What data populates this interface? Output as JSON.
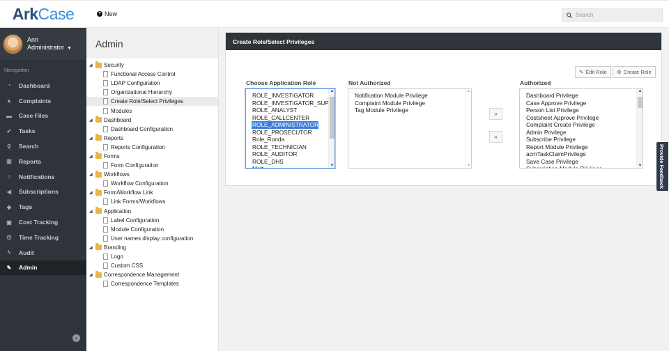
{
  "brand": {
    "part1": "Ark",
    "part2": "Case"
  },
  "header": {
    "new_label": "New",
    "search_placeholder": "Search"
  },
  "user": {
    "first": "Ann",
    "role": "Administrator"
  },
  "nav": {
    "heading": "Navigation",
    "items": [
      {
        "label": "Dashboard",
        "icon": "dashboard-icon",
        "glyph": "◔"
      },
      {
        "label": "Complaints",
        "icon": "warning-icon",
        "glyph": "▲"
      },
      {
        "label": "Case Files",
        "icon": "folder-icon",
        "glyph": "▬"
      },
      {
        "label": "Tasks",
        "icon": "check-circle-icon",
        "glyph": "✔"
      },
      {
        "label": "Search",
        "icon": "search-icon",
        "glyph": "⚲"
      },
      {
        "label": "Reports",
        "icon": "bar-chart-icon",
        "glyph": "▥"
      },
      {
        "label": "Notifications",
        "icon": "bell-icon",
        "glyph": "♫"
      },
      {
        "label": "Subscriptions",
        "icon": "bullhorn-icon",
        "glyph": "◀"
      },
      {
        "label": "Tags",
        "icon": "tag-icon",
        "glyph": "◆"
      },
      {
        "label": "Cost Tracking",
        "icon": "money-icon",
        "glyph": "▣"
      },
      {
        "label": "Time Tracking",
        "icon": "clock-icon",
        "glyph": "◷"
      },
      {
        "label": "Audit",
        "icon": "bolt-icon",
        "glyph": "ϟ"
      },
      {
        "label": "Admin",
        "icon": "wrench-icon",
        "glyph": "✎",
        "active": true
      }
    ]
  },
  "admin": {
    "title": "Admin",
    "tree": [
      {
        "type": "folder",
        "label": "Security"
      },
      {
        "type": "leaf",
        "label": "Functional Access Control"
      },
      {
        "type": "leaf",
        "label": "LDAP Configuration"
      },
      {
        "type": "leaf",
        "label": "Organizational Hierarchy"
      },
      {
        "type": "leaf",
        "label": "Create Role/Select Privileges",
        "selected": true
      },
      {
        "type": "leaf",
        "label": "Modules"
      },
      {
        "type": "folder",
        "label": "Dashboard"
      },
      {
        "type": "leaf",
        "label": "Dashboard Configuration"
      },
      {
        "type": "folder",
        "label": "Reports"
      },
      {
        "type": "leaf",
        "label": "Reports Configuration"
      },
      {
        "type": "folder",
        "label": "Forms"
      },
      {
        "type": "leaf",
        "label": "Form Configuration"
      },
      {
        "type": "folder",
        "label": "Workflows"
      },
      {
        "type": "leaf",
        "label": "Workflow Configuration"
      },
      {
        "type": "folder",
        "label": "Form/Workflow Link"
      },
      {
        "type": "leaf",
        "label": "Link Forms/Workflows"
      },
      {
        "type": "folder",
        "label": "Application"
      },
      {
        "type": "leaf",
        "label": "Label Configuration"
      },
      {
        "type": "leaf",
        "label": "Module Configuration"
      },
      {
        "type": "leaf",
        "label": "User names display configuration"
      },
      {
        "type": "folder",
        "label": "Branding"
      },
      {
        "type": "leaf",
        "label": "Logo"
      },
      {
        "type": "leaf",
        "label": "Custom CSS"
      },
      {
        "type": "folder",
        "label": "Correspondence Management"
      },
      {
        "type": "leaf",
        "label": "Correspondence Templates"
      }
    ]
  },
  "panel": {
    "title": "Create Role/Select Privileges",
    "edit_role": "Edit Role",
    "create_role": "Create Role",
    "roles_label": "Choose  Application Role",
    "not_auth_label": "Not Authorized",
    "auth_label": "Authorized",
    "roles": [
      "ROLE_INVESTIGATOR",
      "ROLE_INVESTIGATOR_SUPERVISOR",
      "ROLE_ANALYST",
      "ROLE_CALLCENTER",
      "ROLE_ADMINISTRATOR",
      "ROLE_PROSECUTOR",
      "Role_Ronda",
      "ROLE_TECHNICIAN",
      "ROLE_AUDITOR",
      "ROLE_DHS",
      "Matt"
    ],
    "selected_role": "ROLE_ADMINISTRATOR",
    "not_authorized": [
      "Notification Module Privilege",
      "Complaint Module Privilege",
      "Tag Module Privilege"
    ],
    "authorized": [
      "Dashboard Privilege",
      "Case Approve Privilege",
      "Person List Privilege",
      "Costsheet Approve Privilege",
      "Complaint Create Privilege",
      "Admin Privilege",
      "Subscribe Privilege",
      "Report Module Privilege",
      "acmTaskClaimPrivilege",
      "Save Case Privilege",
      "Subscription Module Privilege"
    ],
    "move_right": "»",
    "move_left": "«"
  },
  "feedback": "Provide Feedback"
}
